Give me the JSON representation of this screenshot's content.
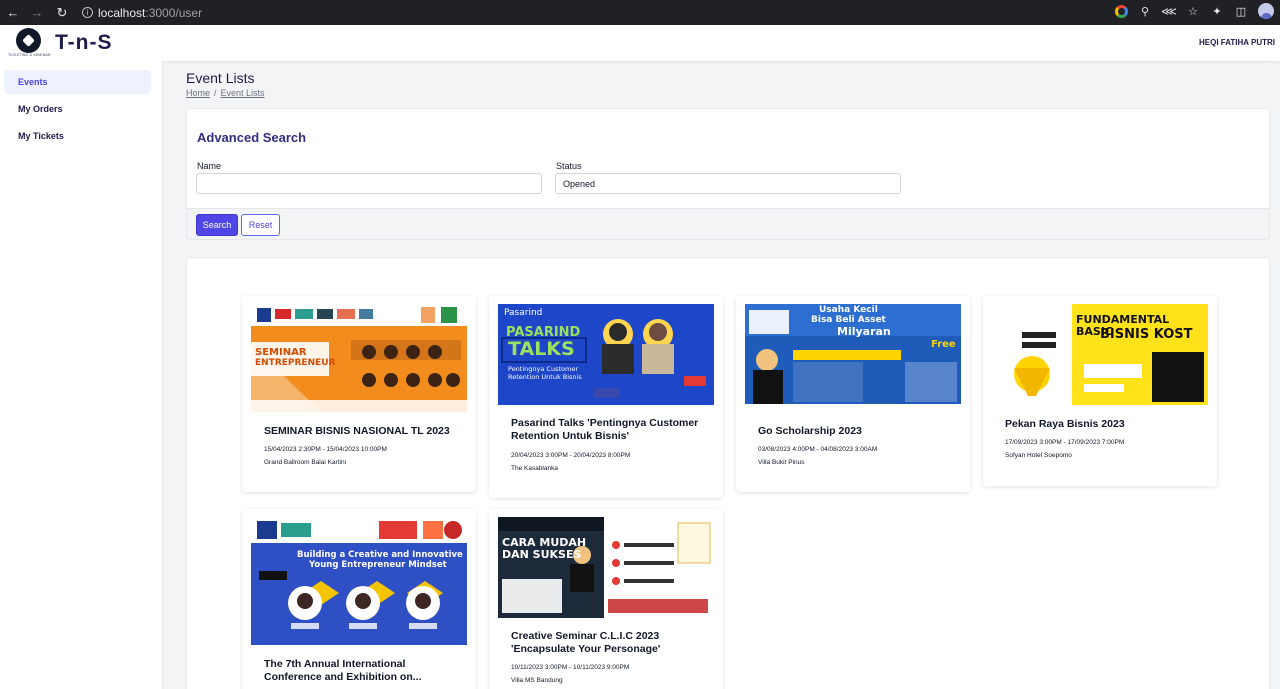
{
  "browser": {
    "url_host": "localhost",
    "url_path": ":3000/user"
  },
  "header": {
    "app_name": "T-n-S",
    "logo_tagline": "TICKETING & SEMINAR",
    "user_name": "HEQI FATIHA PUTRI"
  },
  "sidebar": {
    "items": [
      {
        "label": "Events"
      },
      {
        "label": "My Orders"
      },
      {
        "label": "My Tickets"
      }
    ]
  },
  "page": {
    "title": "Event Lists",
    "breadcrumb": [
      {
        "label": "Home"
      },
      {
        "label": "Event Lists"
      }
    ],
    "breadcrumb_separator": "/"
  },
  "search": {
    "title": "Advanced Search",
    "name_label": "Name",
    "name_value": "",
    "status_label": "Status",
    "status_value": "Opened",
    "search_button": "Search",
    "reset_button": "Reset"
  },
  "events": [
    {
      "title": "SEMINAR BISNIS NASIONAL TL 2023",
      "date": "15/04/2023 2:30PM - 15/04/2023 10:00PM",
      "venue": "Grand Ballroom Balai Kartini",
      "poster": {
        "text1": "SEMINAR",
        "text2": "ENTREPRENEUR",
        "bg": "#f28c1c",
        "accent": "#7a2e0f"
      }
    },
    {
      "title": "Pasarind Talks 'Pentingnya Customer Retention Untuk Bisnis'",
      "date": "20/04/2023 3:00PM - 20/04/2023 8:00PM",
      "venue": "The Kasablanka",
      "poster": {
        "brand": "Pasarind",
        "text1": "PASARIND",
        "text2": "TALKS",
        "text3": "Pentingnya Customer",
        "text4": "Retention Untuk Bisnis",
        "bg": "#1e46c8",
        "accent": "#9be15d"
      }
    },
    {
      "title": "Go Scholarship 2023",
      "date": "03/08/2023 4:00PM - 04/08/2023 3:00AM",
      "venue": "Villa Bukit Pinus",
      "poster": {
        "text1": "Usaha Kecil",
        "text2": "Bisa Beli Asset",
        "text3": "Milyaran",
        "text4": "Free",
        "bg": "#1f5bb8",
        "accent": "#ffd400"
      }
    },
    {
      "title": "Pekan Raya Bisnis 2023",
      "date": "17/09/2023 3:00PM - 17/09/2023 7:00PM",
      "venue": "Sofyan Hotel Soepomo",
      "poster": {
        "text1": "FUNDAMENTAL BASIC",
        "text2": "BISNIS KOST",
        "bg": "#ffe21a",
        "accent": "#111111"
      }
    },
    {
      "title": "The 7th Annual International Conference and Exhibition on...",
      "date": "",
      "venue": "",
      "poster": {
        "text1": "Building a Creative and Innovative",
        "text2": "Young Entrepreneur Mindset",
        "bg": "#2f4fc4",
        "accent": "#f5c400"
      }
    },
    {
      "title": "Creative Seminar C.L.I.C 2023 'Encapsulate Your Personage'",
      "date": "10/11/2023 3:00PM - 10/11/2023 9:00PM",
      "venue": "Villa MS Bandung",
      "poster": {
        "text1": "CARA MUDAH",
        "text2": "DAN SUKSES",
        "bg": "#1d2a3a",
        "accent": "#e0b84a"
      }
    }
  ]
}
